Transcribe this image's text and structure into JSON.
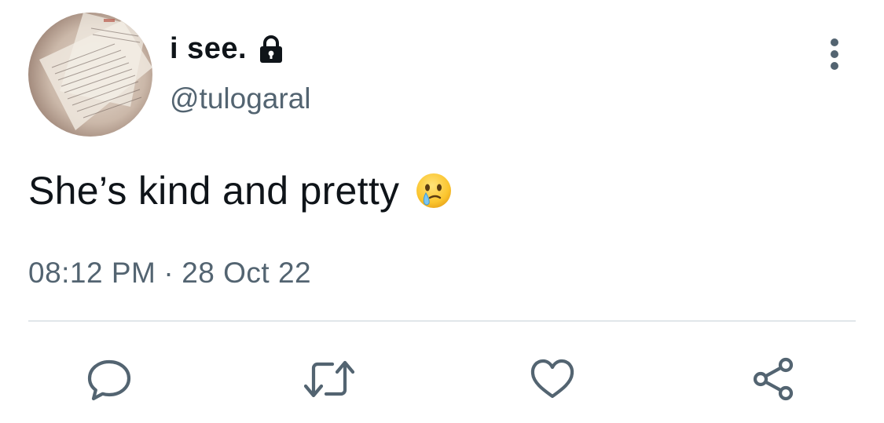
{
  "tweet": {
    "display_name": "i see.",
    "handle": "@tulogaral",
    "text": "She’s kind and pretty",
    "emoji": "face-holding-back-tears",
    "time": "08:12 PM",
    "separator": "·",
    "date": "28 Oct 22",
    "protected_icon": "lock-icon",
    "avatar": "photo-of-handwritten-notes"
  },
  "actions": {
    "reply_icon": "reply-icon",
    "retweet_icon": "retweet-icon",
    "like_icon": "heart-icon",
    "share_icon": "share-icon",
    "more_icon": "more-vertical-icon"
  },
  "colors": {
    "text_primary": "#0f1419",
    "text_secondary": "#536471",
    "divider": "#e1e6ea",
    "icon": "#536471"
  }
}
